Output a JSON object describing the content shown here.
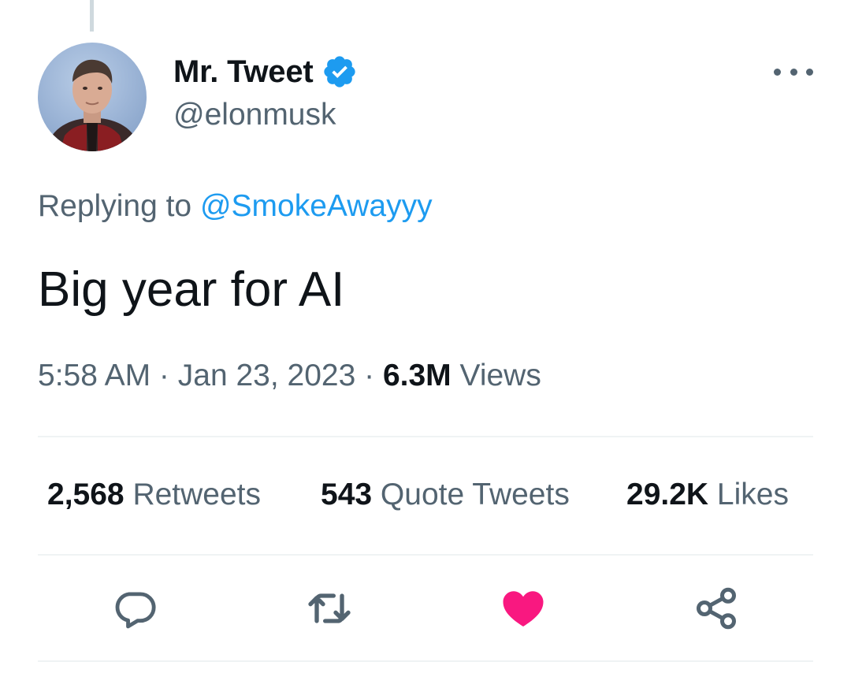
{
  "tweet": {
    "author": {
      "display_name": "Mr. Tweet",
      "handle": "@elonmusk",
      "verified": true,
      "avatar_icon": "profile-photo"
    },
    "replying_to_prefix": "Replying to ",
    "replying_to_handle": "@SmokeAwayyy",
    "text": "Big year for AI",
    "time": "5:58 AM",
    "separator": " · ",
    "date": "Jan 23, 2023",
    "views_count": "6.3M",
    "views_label": " Views"
  },
  "stats": {
    "retweets": {
      "count": "2,568",
      "label": " Retweets"
    },
    "quote_tweets": {
      "count": "543",
      "label": " Quote Tweets"
    },
    "likes": {
      "count": "29.2K",
      "label": " Likes"
    }
  },
  "actions": [
    {
      "name": "reply",
      "icon": "reply-icon"
    },
    {
      "name": "retweet",
      "icon": "retweet-icon"
    },
    {
      "name": "like",
      "icon": "heart-icon",
      "active": true
    },
    {
      "name": "share",
      "icon": "share-icon"
    }
  ],
  "colors": {
    "text_primary": "#0f1419",
    "text_secondary": "#536471",
    "link": "#1d9bf0",
    "verified": "#1d9bf0",
    "like_active": "#f91880",
    "divider": "#eff3f4"
  }
}
